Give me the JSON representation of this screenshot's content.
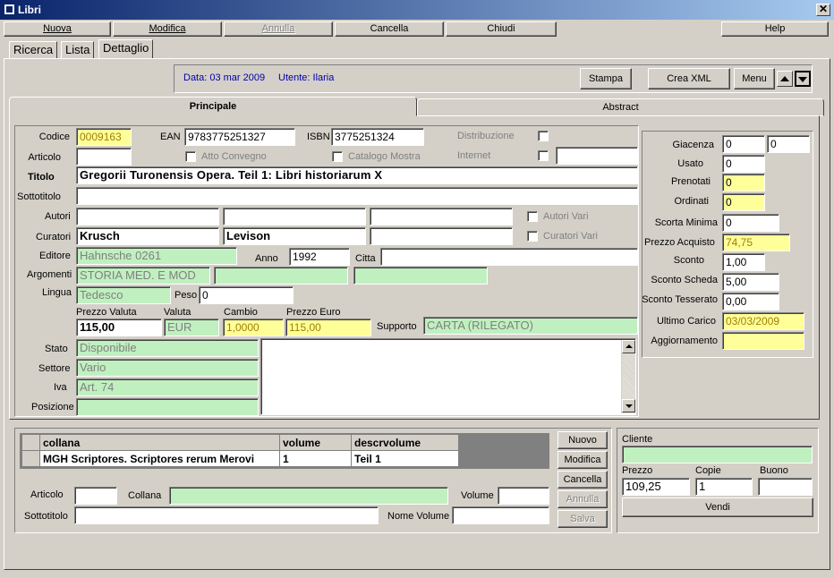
{
  "window": {
    "title": "Libri"
  },
  "toolbar": {
    "nuova": "Nuova",
    "modifica": "Modifica",
    "annulla": "Annulla",
    "cancella": "Cancella",
    "chiudi": "Chiudi",
    "help": "Help"
  },
  "tabs": [
    "Ricerca",
    "Lista",
    "Dettaglio"
  ],
  "info": {
    "date": "Data: 03 mar 2009",
    "user": "Utente: Ilaria"
  },
  "actions": {
    "stampa": "Stampa",
    "crea_xml": "Crea XML",
    "menu": "Menu"
  },
  "subtabs": {
    "principale": "Principale",
    "abstract": "Abstract"
  },
  "form": {
    "codice_label": "Codice",
    "codice": "0009163",
    "ean_label": "EAN",
    "ean": "9783775251327",
    "isbn_label": "ISBN",
    "isbn": "3775251324",
    "distribuzione_label": "Distribuzione",
    "articolo_label": "Articolo",
    "articolo": "",
    "atto_convegno_label": "Atto Convegno",
    "catalogo_mostra_label": "Catalogo Mostra",
    "internet_label": "Internet",
    "internet": "",
    "titolo_label": "Titolo",
    "titolo": "Gregorii Turonensis Opera. Teil 1: Libri historiarum X",
    "sottotitolo_label": "Sottotitolo",
    "sottotitolo": "",
    "autori_label": "Autori",
    "autori": [
      "",
      "",
      ""
    ],
    "autori_vari_label": "Autori Vari",
    "curatori_label": "Curatori",
    "curatori": [
      "Krusch",
      "Levison",
      ""
    ],
    "curatori_vari_label": "Curatori Vari",
    "editore_label": "Editore",
    "editore": "Hahnsche 0261",
    "anno_label": "Anno",
    "anno": "1992",
    "citta_label": "Citta",
    "citta": "",
    "argomenti_label": "Argomenti",
    "argomenti": [
      "STORIA MED. E MOD",
      "",
      ""
    ],
    "lingua_label": "Lingua",
    "lingua": "Tedesco",
    "peso_label": "Peso",
    "peso": "0",
    "prezzo_valuta_label": "Prezzo Valuta",
    "prezzo_valuta": "115,00",
    "valuta_label": "Valuta",
    "valuta": "EUR",
    "cambio_label": "Cambio",
    "cambio": "1,0000",
    "prezzo_euro_label": "Prezzo Euro",
    "prezzo_euro": "115,00",
    "supporto_label": "Supporto",
    "supporto": "CARTA (RILEGATO)",
    "stato_label": "Stato",
    "stato": "Disponibile",
    "settore_label": "Settore",
    "settore": "Vario",
    "iva_label": "Iva",
    "iva": "Art. 74",
    "posizione_label": "Posizione",
    "posizione": ""
  },
  "stock": {
    "giacenza_label": "Giacenza",
    "giacenza": [
      "0",
      "0"
    ],
    "usato_label": "Usato",
    "usato": "0",
    "prenotati_label": "Prenotati",
    "prenotati": "0",
    "ordinati_label": "Ordinati",
    "ordinati": "0",
    "scorta_minima_label": "Scorta Minima",
    "scorta_minima": "0",
    "prezzo_acquisto_label": "Prezzo Acquisto",
    "prezzo_acquisto": "74,75",
    "sconto_label": "Sconto",
    "sconto": "1,00",
    "sconto_scheda_label": "Sconto Scheda",
    "sconto_scheda": "5,00",
    "sconto_tesserato_label": "Sconto Tesserato",
    "sconto_tesserato": "0,00",
    "ultimo_carico_label": "Ultimo Carico",
    "ultimo_carico": "03/03/2009",
    "aggiornamento_label": "Aggiornamento",
    "aggiornamento": ""
  },
  "collana_table": {
    "headers": [
      "collana",
      "volume",
      "descrvolume"
    ],
    "rows": [
      [
        "MGH Scriptores. Scriptores rerum Merovi",
        "1",
        "Teil 1"
      ]
    ]
  },
  "collana_form": {
    "articolo_label": "Articolo",
    "articolo": "",
    "collana_label": "Collana",
    "collana": "",
    "volume_label": "Volume",
    "volume": "",
    "sottotitolo_label": "Sottotitolo",
    "sottotitolo": "",
    "nome_volume_label": "Nome Volume",
    "nome_volume": ""
  },
  "collana_buttons": {
    "nuovo": "Nuovo",
    "modifica": "Modifica",
    "cancella": "Cancella",
    "annulla": "Annulla",
    "salva": "Salva"
  },
  "sale": {
    "cliente_label": "Cliente",
    "cliente": "",
    "prezzo_label": "Prezzo",
    "prezzo": "109,25",
    "copie_label": "Copie",
    "copie": "1",
    "buono_label": "Buono",
    "buono": "",
    "vendi": "Vendi"
  }
}
